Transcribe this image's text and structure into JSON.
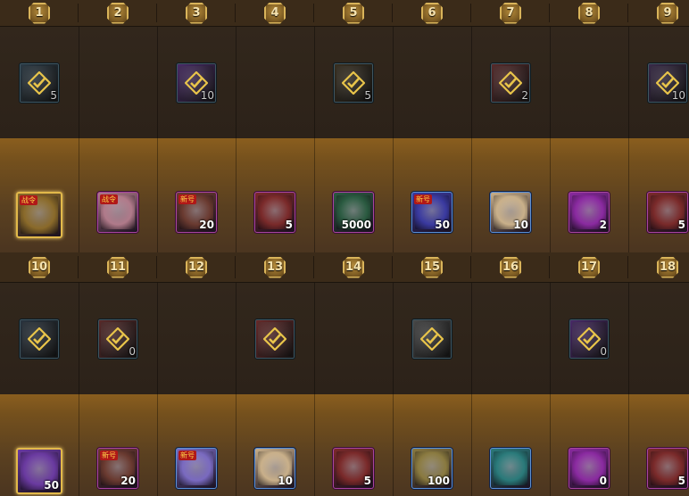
{
  "top": {
    "levels": [
      "1",
      "2",
      "3",
      "4",
      "5",
      "6",
      "7",
      "8",
      "9"
    ],
    "free": [
      {
        "col": 0,
        "qty": "5",
        "icon": "claimed-chest-icon",
        "bg": "#2b3a45"
      },
      {
        "col": 2,
        "qty": "10",
        "icon": "claimed-purple-orb-icon",
        "bg": "#4a2a6a"
      },
      {
        "col": 4,
        "qty": "5",
        "icon": "claimed-chest-icon",
        "bg": "#3a3020"
      },
      {
        "col": 6,
        "qty": "2",
        "icon": "claimed-pouch-icon",
        "bg": "#5a2a2a"
      },
      {
        "col": 8,
        "qty": "10",
        "icon": "claimed-pouch-icon",
        "bg": "#3a2a4a"
      }
    ],
    "paid": [
      {
        "col": 0,
        "qty": "",
        "icon": "golden-chest-icon",
        "frame": "gold",
        "bg": "#8a6a2a",
        "ribbon": "战令"
      },
      {
        "col": 1,
        "qty": "",
        "icon": "pink-box-icon",
        "frame": "purple",
        "bg": "#b07a8a",
        "ribbon": "战令"
      },
      {
        "col": 2,
        "qty": "20",
        "icon": "ticket-chest-icon",
        "frame": "purple",
        "bg": "#6a3a30",
        "ribbon": "新号"
      },
      {
        "col": 3,
        "qty": "5",
        "icon": "red-pouch-icon",
        "frame": "purple",
        "bg": "#7a2a2a"
      },
      {
        "col": 4,
        "qty": "5000",
        "icon": "green-crystal-icon",
        "frame": "purple",
        "bg": "#2a5a40"
      },
      {
        "col": 5,
        "qty": "50",
        "icon": "blue-orb-icon",
        "frame": "blue",
        "bg": "#3a3aa0",
        "ribbon": "新号"
      },
      {
        "col": 6,
        "qty": "10",
        "icon": "feather-wing-icon",
        "frame": "blue",
        "bg": "#c9b08a"
      },
      {
        "col": 7,
        "qty": "2",
        "icon": "purple-orb-icon",
        "frame": "purple",
        "bg": "#8a2aa0"
      },
      {
        "col": 8,
        "qty": "5",
        "icon": "red-pouch-icon",
        "frame": "purple",
        "bg": "#7a2a2a"
      }
    ]
  },
  "bottom": {
    "levels": [
      "10",
      "11",
      "12",
      "13",
      "14",
      "15",
      "16",
      "17",
      "18"
    ],
    "free": [
      {
        "col": 0,
        "qty": "",
        "icon": "claimed-crate-icon",
        "bg": "#2a3540"
      },
      {
        "col": 1,
        "qty": "0",
        "icon": "claimed-pouch-icon",
        "bg": "#5a2a2a"
      },
      {
        "col": 3,
        "qty": "",
        "icon": "claimed-pouch-icon",
        "bg": "#6a2a2a"
      },
      {
        "col": 5,
        "qty": "",
        "icon": "claimed-box-icon",
        "bg": "#4a4a4a"
      },
      {
        "col": 7,
        "qty": "0",
        "icon": "claimed-purple-orb-icon",
        "bg": "#4a2a6a"
      }
    ],
    "paid": [
      {
        "col": 0,
        "qty": "50",
        "icon": "blue-orb-icon",
        "frame": "gold",
        "bg": "#6a3aa0"
      },
      {
        "col": 1,
        "qty": "20",
        "icon": "ticket-chest-icon",
        "frame": "purple",
        "bg": "#6a3a30",
        "ribbon": "新号"
      },
      {
        "col": 2,
        "qty": "",
        "icon": "lavender-orbs-icon",
        "frame": "blue",
        "bg": "#7a6ac0",
        "ribbon": "新号"
      },
      {
        "col": 3,
        "qty": "10",
        "icon": "feather-wing-icon",
        "frame": "blue",
        "bg": "#c9b08a"
      },
      {
        "col": 4,
        "qty": "5",
        "icon": "red-pouch-icon",
        "frame": "purple",
        "bg": "#7a2a2a"
      },
      {
        "col": 5,
        "qty": "100",
        "icon": "gold-medal-icon",
        "frame": "blue",
        "bg": "#8a7a40"
      },
      {
        "col": 6,
        "qty": "",
        "icon": "bronze-coin-icon",
        "frame": "blue",
        "bg": "#2a7a7a"
      },
      {
        "col": 7,
        "qty": "0",
        "icon": "purple-orb-icon",
        "frame": "purple",
        "bg": "#8a2aa0"
      },
      {
        "col": 8,
        "qty": "5",
        "icon": "red-pouch-icon",
        "frame": "purple",
        "bg": "#7a2a2a"
      }
    ]
  },
  "colors": {
    "check": "#e8c44a",
    "panel": "#3b2b19",
    "paidBand": "#8a5e1e"
  }
}
